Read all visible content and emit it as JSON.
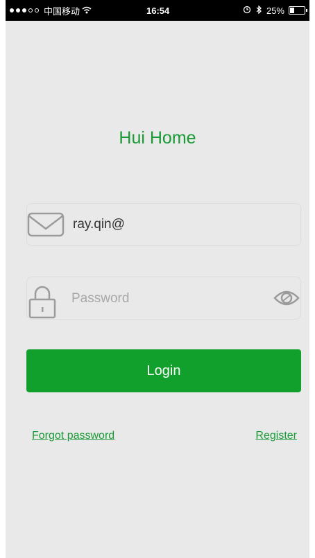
{
  "status_bar": {
    "carrier": "中国移动",
    "time": "16:54",
    "battery": "25%",
    "battery_level": 0.25
  },
  "app": {
    "title": "Hui Home"
  },
  "email_field": {
    "value": "ray.qin@",
    "icon": "envelope-icon"
  },
  "password_field": {
    "placeholder": "Password",
    "icon": "lock-icon",
    "toggle_icon": "eye-icon"
  },
  "login_button": {
    "label": "Login"
  },
  "links": {
    "forgot_password": "Forgot password",
    "register": "Register"
  },
  "colors": {
    "accent": "#10a02b",
    "background": "#e9e9e9"
  }
}
